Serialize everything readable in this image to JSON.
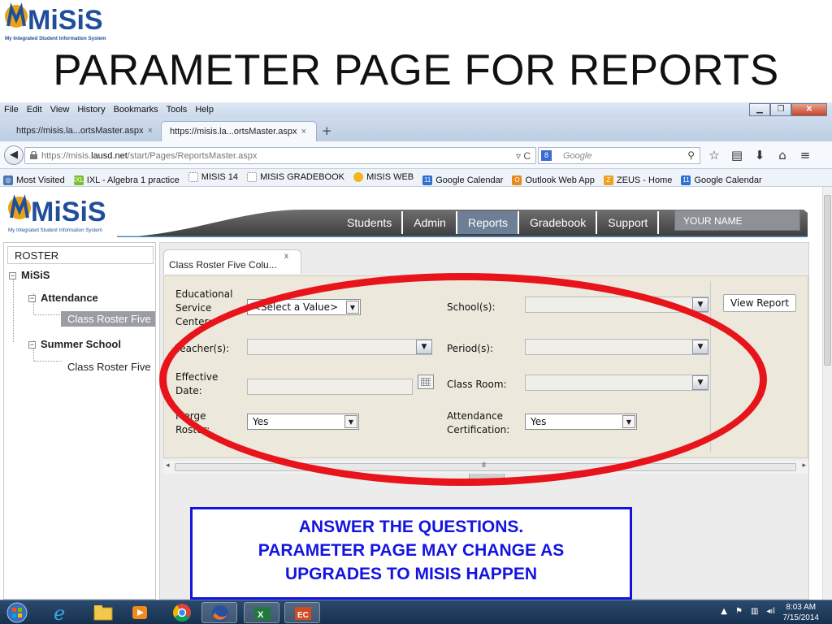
{
  "slide": {
    "logo_text": "MiSiS",
    "logo_tagline": "My Integrated Student Information System",
    "title": "PARAMETER PAGE FOR REPORTS"
  },
  "browser": {
    "menu": [
      "File",
      "Edit",
      "View",
      "History",
      "Bookmarks",
      "Tools",
      "Help"
    ],
    "window_controls": [
      "minimize-icon",
      "restore-icon",
      "close-icon"
    ],
    "tabs": [
      {
        "label": "https://misis.la...ortsMaster.aspx",
        "close": "×"
      },
      {
        "label": "https://misis.la...ortsMaster.aspx",
        "close": "×"
      }
    ],
    "new_tab": "+",
    "address": {
      "prefix": "https://misis.",
      "host": "lausd.net",
      "path": "/start/Pages/ReportsMaster.aspx"
    },
    "search_placeholder": "Google",
    "bookmarks": [
      {
        "label": "Most Visited",
        "color": "#4a77b5"
      },
      {
        "label": "IXL - Algebra 1 practice",
        "color": "#7bbf2a"
      },
      {
        "label": "MISIS 14",
        "color": "#c8c8c8"
      },
      {
        "label": "MISIS GRADEBOOK",
        "color": "#c8c8c8"
      },
      {
        "label": "MISIS WEB",
        "color": "#f2b51b"
      },
      {
        "label": "Google Calendar",
        "color": "#2f6fd6"
      },
      {
        "label": "Outlook Web App",
        "color": "#e8891a"
      },
      {
        "label": "ZEUS - Home",
        "color": "#f0a019"
      },
      {
        "label": "Google Calendar",
        "color": "#2f6fd6"
      }
    ]
  },
  "app": {
    "logo_text": "MiSiS",
    "logo_tagline": "My Integrated Student Information System",
    "nav": [
      "Students",
      "Admin",
      "Reports",
      "Gradebook",
      "Support"
    ],
    "active_nav": "Reports",
    "user_name": "YOUR NAME",
    "sidebar": {
      "search_value": "ROSTER",
      "root": "MiSiS",
      "groups": [
        {
          "label": "Attendance",
          "items": [
            "Class Roster Five"
          ]
        },
        {
          "label": "Summer School",
          "items": [
            "Class Roster Five"
          ]
        }
      ]
    },
    "content_tab": {
      "label": "Class Roster Five Colu...",
      "close": "x"
    },
    "params": {
      "educational_service_center": {
        "label": "Educational Service Center:",
        "value": "<Select a Value>"
      },
      "schools": {
        "label": "School(s):",
        "value": ""
      },
      "teachers": {
        "label": "Teacher(s):",
        "value": ""
      },
      "periods": {
        "label": "Period(s):",
        "value": ""
      },
      "effective_date": {
        "label": "Effective Date:",
        "value": ""
      },
      "class_room": {
        "label": "Class Room:",
        "value": ""
      },
      "merge_roster": {
        "label": "Merge Roster:",
        "value": "Yes"
      },
      "attendance_certification": {
        "label": "Attendance Certification:",
        "value": "Yes"
      },
      "view_report_label": "View Report"
    },
    "hscroll_grip": "III"
  },
  "note": {
    "line1": "ANSWER THE QUESTIONS.",
    "line2": "PARAMETER PAGE MAY CHANGE AS",
    "line3": "UPGRADES TO MISIS HAPPEN"
  },
  "taskbar": {
    "apps": [
      "start-orb-icon",
      "internet-explorer-icon",
      "file-explorer-icon",
      "media-player-icon",
      "chrome-icon",
      "firefox-icon",
      "excel-icon",
      "powerpoint-icon"
    ],
    "time": "8:03 AM",
    "date": "7/15/2014"
  },
  "colors": {
    "misis_gold": "#e8a317",
    "misis_blue": "#1f4e9a",
    "highlight_red": "#e8141b",
    "note_blue": "#1414e0",
    "nav_active": "#6d7f96"
  }
}
